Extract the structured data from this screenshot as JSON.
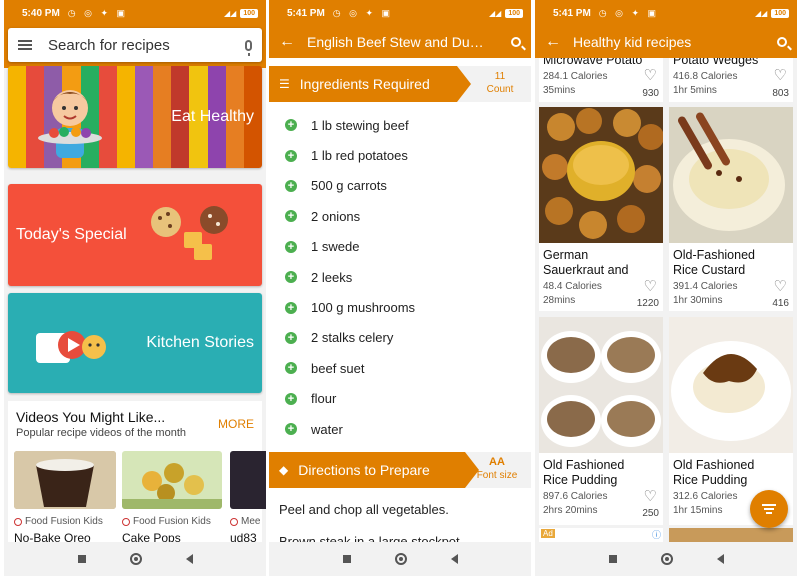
{
  "status": {
    "time": "5:40 PM",
    "time2": "5:41 PM",
    "time3": "5:41 PM",
    "battery": "100"
  },
  "home": {
    "search_placeholder": "Search for recipes",
    "cards": [
      {
        "label": "Eat Healthy"
      },
      {
        "label": "Today's Special"
      },
      {
        "label": "Kitchen Stories"
      }
    ],
    "videos": {
      "title": "Videos You Might Like...",
      "subtitle": "Popular recipe videos of the month",
      "more": "MORE",
      "items": [
        {
          "source": "Food Fusion Kids",
          "name": "No-Bake Oreo"
        },
        {
          "source": "Food Fusion Kids",
          "name": "Cake Pops"
        },
        {
          "source": "Mee",
          "name": "ud83"
        }
      ]
    }
  },
  "recipe": {
    "title": "English Beef Stew and Dum…",
    "ingredients_header": "Ingredients Required",
    "count_value": "11",
    "count_label": "Count",
    "ingredients": [
      "1 lb stewing beef",
      "1 lb red potatoes",
      "500 g carrots",
      "2 onions",
      "1 swede",
      "2 leeks",
      "100 g mushrooms",
      "2 stalks celery",
      "beef suet",
      "flour",
      "water"
    ],
    "directions_header": "Directions to Prepare",
    "font_size_icon": "AA",
    "font_size_label": "Font size",
    "step1": "Peel and chop all vegetables.",
    "step2": "Brown steak in a large stockpot"
  },
  "kids": {
    "title": "Healthy kid recipes",
    "top_row": [
      {
        "title": "Microwave Potato",
        "calories": "284.1 Calories",
        "time": "35mins",
        "likes": "930"
      },
      {
        "title": "Potato Wedges",
        "calories": "416.8 Calories",
        "time": "1hr 5mins",
        "likes": "803"
      }
    ],
    "row2": [
      {
        "title_line1": "German",
        "title_line2": "Sauerkraut and",
        "calories": "48.4 Calories",
        "time": "28mins",
        "likes": "1220"
      },
      {
        "title_line1": "Old-Fashioned",
        "title_line2": "Rice Custard",
        "calories": "391.4 Calories",
        "time": "1hr 30mins",
        "likes": "416"
      }
    ],
    "row3": [
      {
        "title_line1": "Old Fashioned",
        "title_line2": "Rice Pudding",
        "calories": "897.6 Calories",
        "time": "2hrs 20mins",
        "likes": "250"
      },
      {
        "title_line1": "Old Fashioned",
        "title_line2": "Rice Pudding",
        "calories": "312.6 Calories",
        "time": "1hr 15mins",
        "likes": ""
      }
    ],
    "ad_label": "Ad"
  },
  "colors": {
    "accent": "#e07f00",
    "special": "#f4503a",
    "kitchen": "#2aaeb3",
    "plus": "#4caf50"
  }
}
